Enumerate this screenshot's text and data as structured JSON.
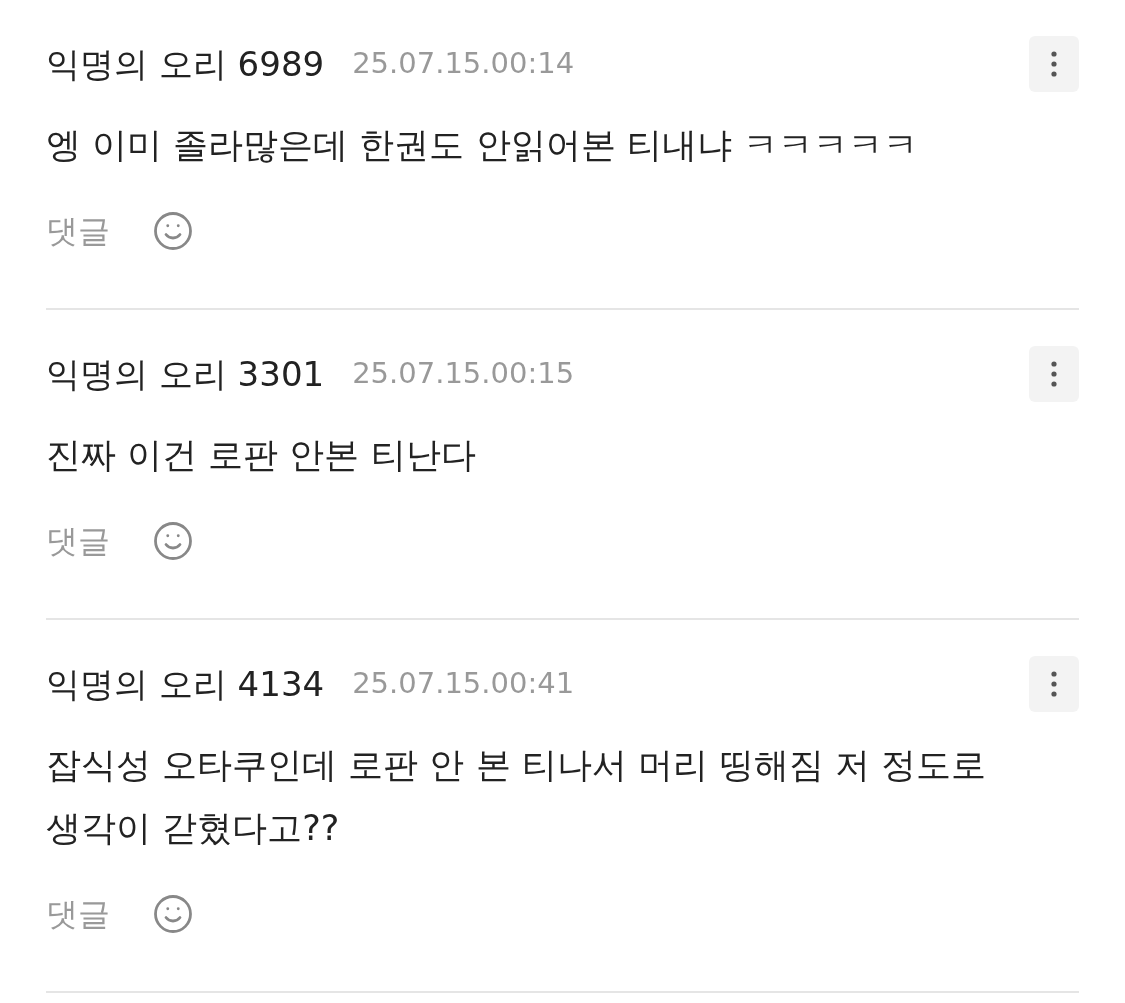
{
  "comments": [
    {
      "author": "익명의 오리 6989",
      "timestamp": "25.07.15.00:14",
      "body": "엥 이미 졸라많은데 한권도 안읽어본 티내냐 ㅋㅋㅋㅋㅋ",
      "reply_label": "댓글"
    },
    {
      "author": "익명의 오리 3301",
      "timestamp": "25.07.15.00:15",
      "body": "진짜 이건 로판 안본 티난다",
      "reply_label": "댓글"
    },
    {
      "author": "익명의 오리 4134",
      "timestamp": "25.07.15.00:41",
      "body": "잡식성 오타쿠인데 로판 안 본 티나서 머리 띵해짐 저 정도로 생각이 갇혔다고??",
      "reply_label": "댓글"
    }
  ]
}
